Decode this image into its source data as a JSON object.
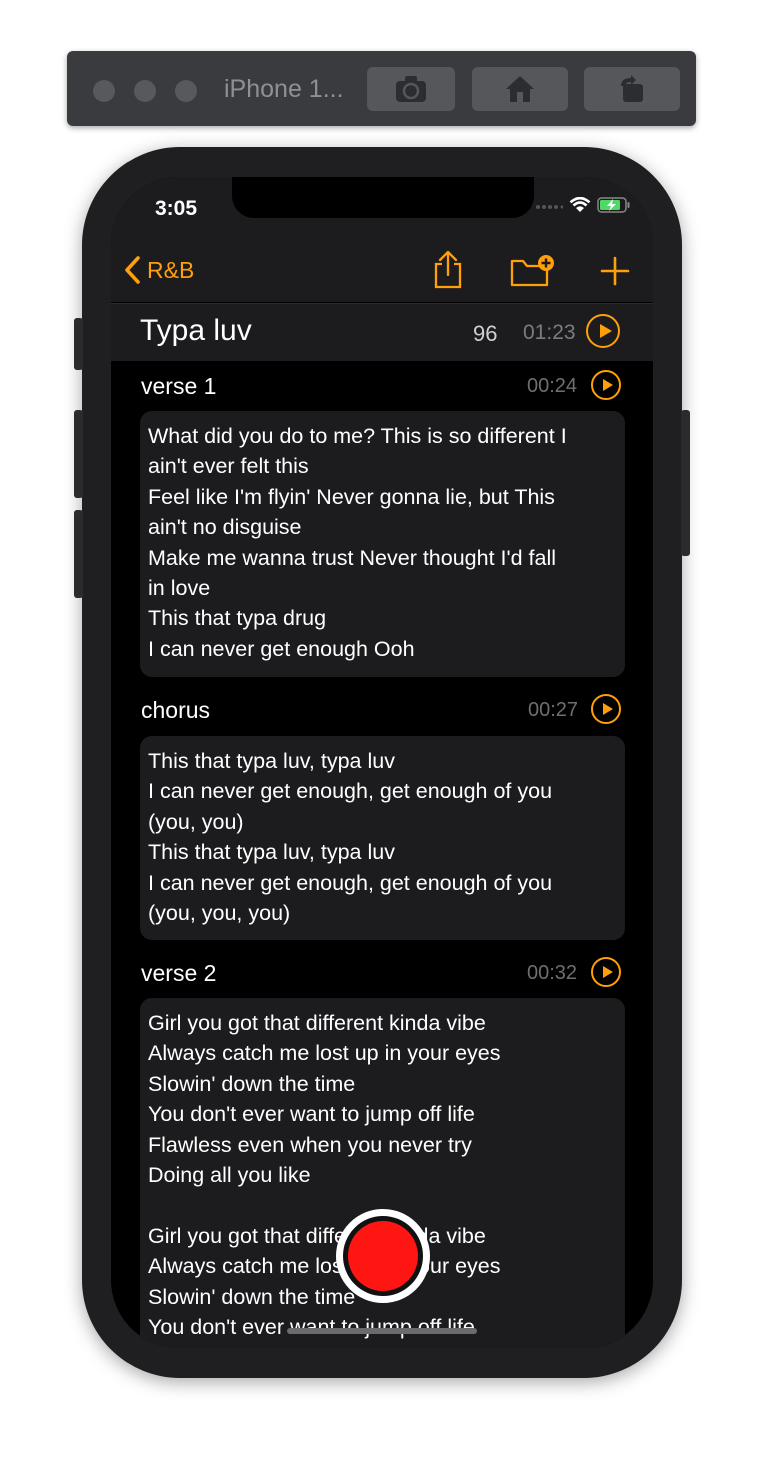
{
  "simulator": {
    "device_name": "iPhone 1..."
  },
  "status": {
    "time": "3:05"
  },
  "nav": {
    "back_label": "R&B"
  },
  "song": {
    "title": "Typa luv",
    "bpm": "96",
    "duration": "01:23"
  },
  "sections": [
    {
      "name": "verse 1",
      "time": "00:24",
      "lines": [
        "What did you do to me? This is so different I",
        "ain't ever felt this",
        "Feel like I'm flyin' Never gonna lie, but This",
        "ain't no disguise",
        "Make me wanna trust Never thought I'd fall",
        "in love",
        "This that typa drug",
        "I can never get enough Ooh"
      ]
    },
    {
      "name": "chorus",
      "time": "00:27",
      "lines": [
        "This that typa luv, typa luv",
        "I can never get enough, get enough of you",
        "(you, you)",
        "This that typa luv, typa luv",
        "I can never get enough, get enough of you",
        "(you, you, you)"
      ]
    },
    {
      "name": "verse 2",
      "time": "00:32",
      "lines": [
        "Girl you got that different kinda vibe",
        "Always catch me lost up in your eyes",
        "Slowin' down the time",
        "You don't ever want to jump off life",
        "Flawless even when you never try",
        "Doing all you like",
        "",
        "Girl you got that different kinda vibe",
        "Always catch me lost up in your eyes",
        "Slowin' down the time",
        "You don't ever want to jump off life"
      ]
    }
  ],
  "colors": {
    "accent": "#ff9f0a",
    "record": "#ff1612",
    "card": "#1c1c1e",
    "background": "#000000"
  }
}
